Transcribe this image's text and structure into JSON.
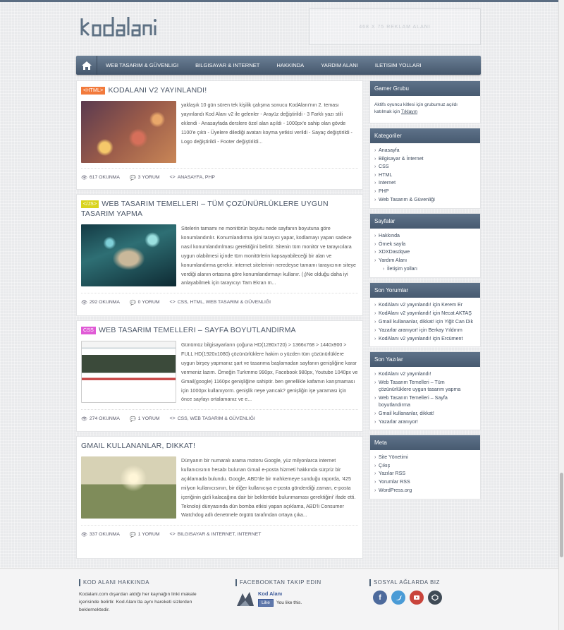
{
  "header": {
    "logo_text": "kodalanı",
    "ad_text": "468 X 75 REKLAM ALANI"
  },
  "nav": {
    "items": [
      "WEB TASARIM & GÜVENLIGI",
      "BILGISAYAR & INTERNET",
      "HAKKINDA",
      "YARDIM ALANI",
      "ILETISIM YOLLARI"
    ]
  },
  "posts": [
    {
      "tag": "<HTML>",
      "tag_color": "#f27a3c",
      "title": "KODALANI V2 YAYINLANDI!",
      "excerpt": "yaklaşık 10 gün süren tek kişilik çalışma sonucu KodAlanı'nın 2. teması yayınlandı Kod Alanı v2 ile gelenler - Arayüz değiştirildi - 3 Farklı yazı stili eklendi - Anasayfada derslere özel alan açıldı - 1000px'e sahip olan gövde 1100'e çıktı - Üyelere dilediği avatarı koyma yetkisi verildi - Sayaç değiştirildi - Logo değiştirildi - Footer değiştirildi...",
      "views": "617 OKUNMA",
      "comments": "3 YORUM",
      "cats": "ANASAYFA, PHP"
    },
    {
      "tag": "</JS>",
      "tag_color": "#d9d420",
      "title": "WEB TASARIM TEMELLERI – TÜM ÇOZÜNÜRLÜKLERE UYGUN TASARIM YAPMA",
      "excerpt": "Sitelerin tamamı ne monitörün boyutu nede sayfanın boyutuna göre konumlandırılır. Konumlandırma işini tarayıcı yapar, kodlamayı yapan sadece nasıl konumlandırılması gerektiğini belirtir. Sitenin tüm monitör ve tarayıcılara uygun olabilmesi içinde tüm monitörlerin kapsayabileceği bir alan ve konumlandırma gerekir. internet sitelerinin neredeyse tamamı tarayıcının siteye verdiği alanın ortasına göre konumlandırmayı kullanır. (¡)Ne olduğu daha iyi anlayabilmek için tarayıcıyı Tam Ekran m...",
      "views": "292 OKUNMA",
      "comments": "0 YORUM",
      "cats": "CSS, HTML, WEB TASARIM & GÜVENLIĞI"
    },
    {
      "tag": "CSS",
      "tag_color": "#e05bd6",
      "title": "WEB TASARIM TEMELLERI – SAYFA BOYUTLANDIRMA",
      "excerpt": "Günümüz bilgisayarların çoğuna HD(1280x720) > 1366x768 > 1440x900 > FULL HD(1920x1080) çözünürlüklere hakim o yüzden tüm çözünürlüklere uygun birşey yapmanız şart ve tasarıma başlamadan sayfanın genişliğine karar vermeniz lazım. Örneğin Turkmmo 990px, Facebook 980px, Youtube 1040px ve Gmail(google) 1160px genişliğine sahiptir. ben genellikle kafamın karışmaması için 1000px kullanıyorm. genişlik neye yarıcak? genişliğin işe yaraması için önce sayfayı ortalamanız ve e...",
      "views": "274 OKUNMA",
      "comments": "1 YORUM",
      "cats": "CSS, WEB TASARIM & GÜVENLIĞI"
    },
    {
      "tag": "",
      "tag_color": "",
      "title": "GMAIL KULLANANLAR, DIKKAT!",
      "excerpt": "Dünyanın bir numaralı arama motoru Google, yüz milyonlarca internet kullanıcısının hesabı bulunan Gmail e-posta hizmeti hakkında sürpriz bir açıklamada bulundu. Google, ABD'de bir mahkemeye sunduğu raporda, '425 milyon kullanıcısının, bir diğer kullanıcıya e-posta gönderdiği zaman, e-posta içeriğinin gizli kalacağına dair bir beklentide bulunmaması gerektiğini' ifade etti. Teknoloji dünyasında dün bomba etkisi yapan açıklama, ABD'li Consumer Watchdog adlı denetmele örgütü tarafından ortaya çıka...",
      "views": "337 OKUNMA",
      "comments": "1 YORUM",
      "cats": "BILGISAYAR & INTERNET, INTERNET"
    }
  ],
  "sidebar": {
    "gamer": {
      "title": "Gamer Grubu",
      "text": "Aktifs oyuncu kitlesi için grubumuz açıldı katılmak için ",
      "link": "Tıklayın"
    },
    "categories": {
      "title": "Kategoriler",
      "items": [
        "Anasayfa",
        "Bilgisayar & İnternet",
        "CSS",
        "HTML",
        "Internet",
        "PHP",
        "Web Tasarım & Güvenliği"
      ]
    },
    "pages": {
      "title": "Sayfalar",
      "items": [
        "Hakkında",
        "Örnek sayfa",
        "XDXDasdqwe",
        "Yardım Alanı"
      ],
      "sub": "İletişim yolları"
    },
    "comments": {
      "title": "Son Yorumlar",
      "items": [
        "KodAlanı v2 yayınlandı! için Kerem Er",
        "KodAlanı v2 yayınlandı! için Necat AKTAŞ",
        "Gmail kullananlar, dikkat! için Yiğit Can Dik",
        "Yazarlar aranıyor! için Berkay Yıldırım",
        "KodAlanı v2 yayınlandı! için Ercüment"
      ]
    },
    "recent": {
      "title": "Son Yazılar",
      "items": [
        "KodAlanı v2 yayınlandı!",
        "Web Tasarım Temelleri – Tüm çözünürlüklere uygun tasarım yapma",
        "Web Tasarım Temelleri – Sayfa boyutlandırma",
        "Gmail kullananlar, dikkat!",
        "Yazarlar aranıyor!"
      ]
    },
    "meta": {
      "title": "Meta",
      "items": [
        "Site Yönetimi",
        "Çıkış",
        "Yazılar RSS",
        "Yorumlar RSS",
        "WordPress.org"
      ]
    }
  },
  "footer": {
    "about_title": "KOD ALANI HAKKINDA",
    "about_text": "Kodalani.com dışardan aldığı her kaynağın linki makale içerisinde belirtir. Kod Alanı'da aynı hareketi sizlerden beklemektedir.",
    "fb_title": "FACEBOOKTAN TAKIP EDIN",
    "fb_name": "Kod Alanı",
    "fb_like": "Like",
    "fb_like_text": "You like this.",
    "social_title": "SOSYAL AĞLARDA BIZ",
    "social_icons": [
      "facebook-icon",
      "twitter-icon",
      "youtube-icon",
      "share-icon"
    ]
  },
  "colors": {
    "nav_bg": "#4f6378",
    "accent": "#5e7289"
  }
}
